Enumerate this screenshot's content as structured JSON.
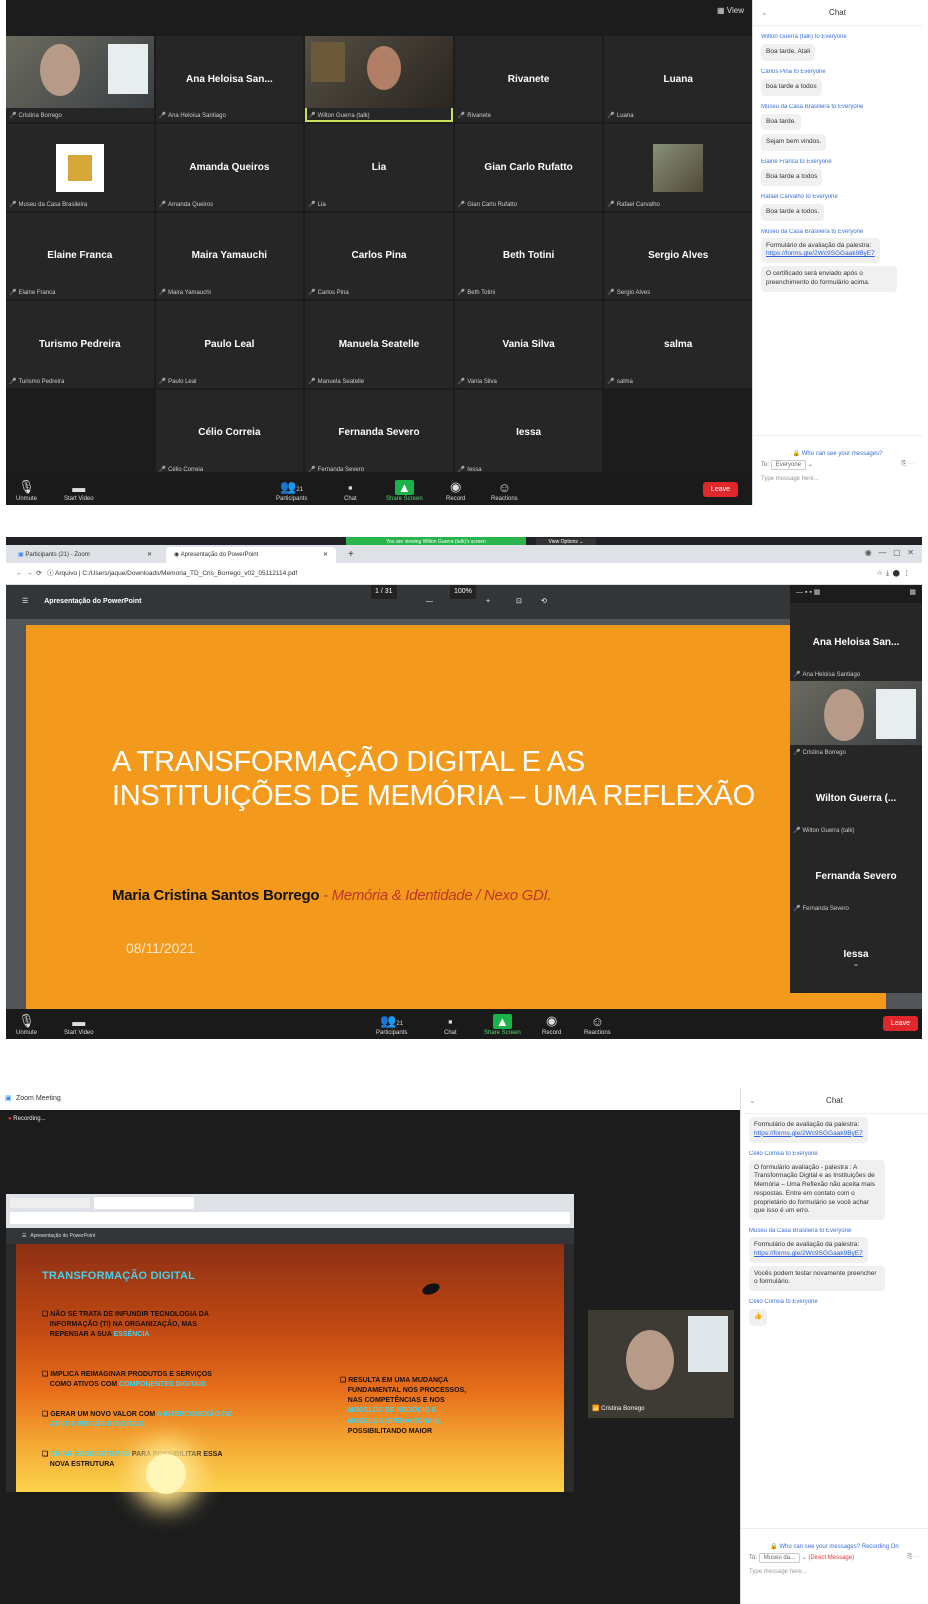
{
  "screen1": {
    "view_label": "View",
    "tiles": [
      {
        "kind": "video",
        "label": "Cristina Borrego"
      },
      {
        "kind": "name",
        "name": "Ana Heloisa San...",
        "label": "Ana Heloisa Santiago"
      },
      {
        "kind": "video-man",
        "label": "Wilton Guerra (talk)"
      },
      {
        "kind": "name",
        "name": "Rivanete",
        "label": "Rivanete"
      },
      {
        "kind": "name",
        "name": "Luana",
        "label": "Luana"
      },
      {
        "kind": "logo",
        "label": "Museu da Casa Brasileira"
      },
      {
        "kind": "name",
        "name": "Amanda Queiros",
        "label": "Amanda Queiros"
      },
      {
        "kind": "name",
        "name": "Lia",
        "label": "Lia"
      },
      {
        "kind": "name",
        "name": "Gian Carlo Rufatto",
        "label": "Gian Carlo Rufatto"
      },
      {
        "kind": "mini",
        "label": "Rafael Carvalho"
      },
      {
        "kind": "name",
        "name": "Elaine Franca",
        "label": "Elaine Franca"
      },
      {
        "kind": "name",
        "name": "Maira Yamauchi",
        "label": "Maira Yamauchi"
      },
      {
        "kind": "name",
        "name": "Carlos Pina",
        "label": "Carlos Pina"
      },
      {
        "kind": "name",
        "name": "Beth Totini",
        "label": "Beth Totini"
      },
      {
        "kind": "name",
        "name": "Sergio Alves",
        "label": "Sergio Alves"
      },
      {
        "kind": "name",
        "name": "Turismo Pedreira",
        "label": "Turismo Pedreira"
      },
      {
        "kind": "name",
        "name": "Paulo Leal",
        "label": "Paulo Leal"
      },
      {
        "kind": "name",
        "name": "Manuela Seatelle",
        "label": "Manuela Seatelle"
      },
      {
        "kind": "name",
        "name": "Vania Silva",
        "label": "Vania Silva"
      },
      {
        "kind": "name",
        "name": "salma",
        "label": "salma"
      },
      {
        "kind": "empty",
        "label": ""
      },
      {
        "kind": "name",
        "name": "Célio Correia",
        "label": "Célio Correia"
      },
      {
        "kind": "name",
        "name": "Fernanda Severo",
        "label": "Fernanda Severo"
      },
      {
        "kind": "name",
        "name": "Iessa",
        "label": "Iessa"
      },
      {
        "kind": "empty",
        "label": ""
      }
    ],
    "toolbar": {
      "unmute": "Unmute",
      "start_video": "Start Video",
      "participants": "Participants",
      "participant_count": "21",
      "chat": "Chat",
      "share": "Share Screen",
      "record": "Record",
      "reactions": "Reactions",
      "end": "Leave"
    },
    "chat": {
      "title": "Chat",
      "messages": [
        {
          "from": "Wilton Guerra (talk) to Everyone",
          "texts": [
            "Boa tarde, Atali"
          ]
        },
        {
          "from": "Carlos Pina to Everyone",
          "texts": [
            "boa tarde a todos"
          ]
        },
        {
          "from": "Museu da Casa Brasileira to Everyone",
          "texts": [
            "Boa tarde.",
            "Sejam bem vindos."
          ]
        },
        {
          "from": "Elaine Franca to Everyone",
          "texts": [
            "Boa tarde a todos"
          ]
        },
        {
          "from": "Rafael Carvalho to Everyone",
          "texts": [
            "Boa tarde a todos."
          ]
        },
        {
          "from": "Museu da Casa Brasileira to Everyone",
          "texts": [
            "Formulário de avaliação da palestra:"
          ],
          "link": "https://forms.gle/2Wc9SGGaak9ByE7"
        },
        {
          "from": "",
          "texts": [
            "O certificado será enviado após o preenchimento do formulário acima."
          ]
        }
      ],
      "who_can_see": "Who can see your messages?",
      "to_label": "To:",
      "to_value": "Everyone",
      "placeholder": "Type message here..."
    }
  },
  "screen2": {
    "share_banner": "You are viewing Wilton Guerra (talk)'s screen",
    "view_options": "View Options",
    "tab1": "Participants (21) - Zoom",
    "tab2": "Apresentação do PowerPoint",
    "address": "Arquivo | C:/Users/jaque/Downloads/Memoria_TD_Cris_Borrego_v02_05112114.pdf",
    "pdf_title": "Apresentação do PowerPoint",
    "page": "1 / 31",
    "zoom": "100%",
    "slide": {
      "title_line1": "A TRANSFORMAÇÃO DIGITAL E AS",
      "title_line2": "INSTITUIÇÕES DE MEMÓRIA – UMA REFLEXÃO",
      "author": "Maria Cristina Santos Borrego",
      "affiliation": " - Memória & Identidade / Nexo GDI.",
      "date": "08/11/2021"
    },
    "side": [
      {
        "kind": "name",
        "name": "Ana Heloisa San...",
        "label": "Ana Heloisa Santiago"
      },
      {
        "kind": "video",
        "label": "Cristina Borrego"
      },
      {
        "kind": "name",
        "name": "Wilton Guerra (...",
        "label": "Wilton Guerra (talk)"
      },
      {
        "kind": "name",
        "name": "Fernanda Severo",
        "label": "Fernanda Severo"
      },
      {
        "kind": "name",
        "name": "Iessa",
        "label": ""
      }
    ],
    "toolbar": {
      "unmute": "Unmute",
      "start_video": "Start Video",
      "participants": "Participants",
      "participant_count": "21",
      "chat": "Chat",
      "share": "Share Screen",
      "record": "Record",
      "reactions": "Reactions",
      "end": "Leave"
    }
  },
  "screen3": {
    "window_title": "Zoom Meeting",
    "recording": "Recording...",
    "slide": {
      "heading": "TRANSFORMAÇÃO DIGITAL",
      "b1a": "NÃO SE TRATA DE INFUNDIR TECNOLOGIA DA",
      "b1b": "INFORMAÇÃO (TI) NA ORGANIZAÇÃO, MAS",
      "b1c": "REPENSAR A SUA ",
      "b1d": "ESSÊNCIA",
      "b2a": "IMPLICA REIMAGINAR PRODUTOS E SERVIÇOS",
      "b2b": "COMO ATIVOS COM ",
      "b2c": "COMPONENTES DIGITAIS",
      "b3a": "GERAR UM NOVO VALOR COM ",
      "b3b": "A INTERCONEXÃO DE",
      "b3c": "ATIVOS FÍSICOS E DIGITAIS",
      "b4a": "CRIAR ECOSSISTEMAS",
      "b4b": " PARA POSSIBILITAR ESSA",
      "b4c": "NOVA ESTRUTURA",
      "r1": "RESULTA EM UMA MUDANÇA",
      "r2": "FUNDAMENTAL NOS PROCESSOS,",
      "r3": "NAS COMPETÊNCIAS E NOS",
      "r4": "MODELOS DE NEGÓCIO E",
      "r5": "MODELOS OPERACIONAIS,",
      "r6": "POSSIBILITANDO MAIOR"
    },
    "cam_label": "Cristina Borrego",
    "chat": {
      "title": "Chat",
      "messages": [
        {
          "from": "",
          "texts": [
            "Formulário de avaliação da palestra:"
          ],
          "link": "https://forms.gle/2Wc9SGGaak9ByE7"
        },
        {
          "from": "Célio Correia to Everyone",
          "texts": [
            "O formulário avaliação - palestra : A Transformação Digital e as Instituições de Memória – Uma Reflexão não aceita mais respostas. Entre em contato com o proprietário do formulário se você achar que isso é um erro."
          ]
        },
        {
          "from": "Museu da Casa Brasileira to Everyone",
          "texts": [
            "Formulário de avaliação da palestra:"
          ],
          "link": "https://forms.gle/2Wc9SGGaak9ByE7"
        },
        {
          "from": "",
          "texts": [
            "Vocês podem testar novamente preencher o formulário."
          ]
        },
        {
          "from": "Célio Correia to Everyone",
          "texts": [
            "👍"
          ]
        }
      ],
      "who_can_see": "Who can see your messages? Recording On",
      "to_label": "To:",
      "to_value": "Museu da...",
      "direct": "(Direct Message)",
      "placeholder": "Type message here..."
    }
  }
}
